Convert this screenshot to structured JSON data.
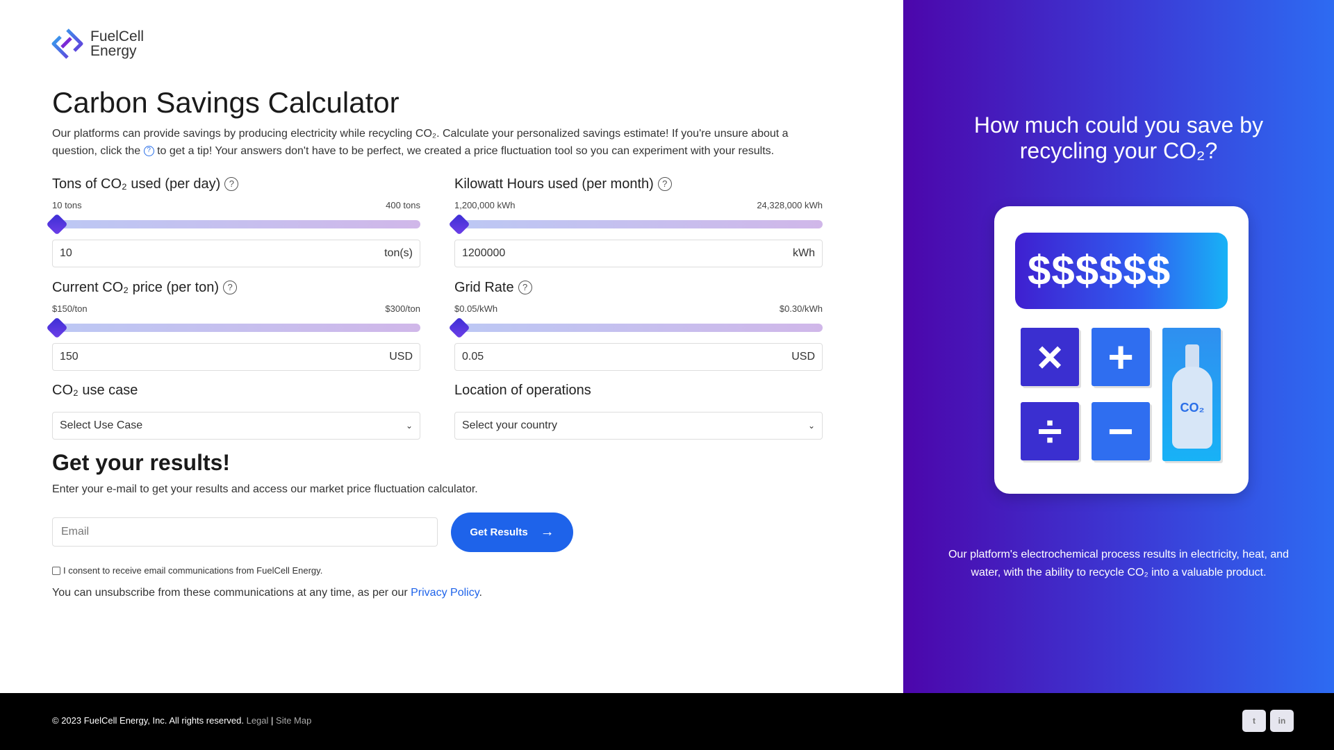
{
  "brand": {
    "name_line1": "FuelCell",
    "name_line2": "Energy"
  },
  "page": {
    "title": "Carbon Savings Calculator",
    "intro_part1": "Our platforms can provide savings by producing electricity while recycling CO₂. Calculate your personalized savings estimate! If you're unsure about a question, click the",
    "intro_help_glyph": "?",
    "intro_part2": "to get a tip! Your answers don't have to be perfect, we created a price fluctuation tool so you can experiment with your results."
  },
  "fields": {
    "tons": {
      "label": "Tons of CO₂ used (per day)",
      "min_label": "10 tons",
      "max_label": "400 tons",
      "value": "10",
      "unit": "ton(s)",
      "slider_fraction": 0
    },
    "kwh": {
      "label": "Kilowatt Hours used (per month)",
      "min_label": "1,200,000 kWh",
      "max_label": "24,328,000 kWh",
      "value": "1200000",
      "unit": "kWh",
      "slider_fraction": 0
    },
    "price": {
      "label": "Current CO₂ price (per ton)",
      "min_label": "$150/ton",
      "max_label": "$300/ton",
      "value": "150",
      "unit": "USD",
      "slider_fraction": 0
    },
    "grid": {
      "label": "Grid Rate",
      "min_label": "$0.05/kWh",
      "max_label": "$0.30/kWh",
      "value": "0.05",
      "unit": "USD",
      "slider_fraction": 0
    },
    "help_glyph": "?"
  },
  "selects": {
    "use_case": {
      "label": "CO₂ use case",
      "value": "Select Use Case"
    },
    "location": {
      "label": "Location of operations",
      "value": "Select your country"
    },
    "chevron": "⌄"
  },
  "results": {
    "title": "Get your results!",
    "subtitle": "Enter your e-mail to get your results and access our market price fluctuation calculator.",
    "email_placeholder": "Email",
    "button_label": "Get Results",
    "button_arrow": "→",
    "consent": "I consent to receive email communications from FuelCell Energy.",
    "unsub_text": "You can unsubscribe from these communications at any time, as per our",
    "privacy_link": "Privacy Policy",
    "unsub_end": "."
  },
  "panel": {
    "title_line1": "How much could you save by",
    "title_line2": "recycling your CO₂?",
    "screen_text": "$$$$$$",
    "keys": {
      "multiply": "×",
      "plus": "+",
      "divide": "÷",
      "minus": "−"
    },
    "bottle_label": "CO₂",
    "description": "Our platform's electrochemical process results in electricity, heat, and water, with the ability to recycle CO₂ into a valuable product.",
    "colors": {
      "gradient_start": "#4c06ab",
      "gradient_end": "#2d6bf2",
      "key_dark": "#3a2fd0",
      "key_blue": "#2f6ef0"
    }
  },
  "footer": {
    "copyright": "© 2023 FuelCell Energy, Inc. All rights reserved.",
    "legal": "Legal",
    "separator": "|",
    "sitemap": "Site Map",
    "social": [
      {
        "icon": "twitter-icon",
        "glyph": "t"
      },
      {
        "icon": "linkedin-icon",
        "glyph": "in"
      }
    ]
  }
}
